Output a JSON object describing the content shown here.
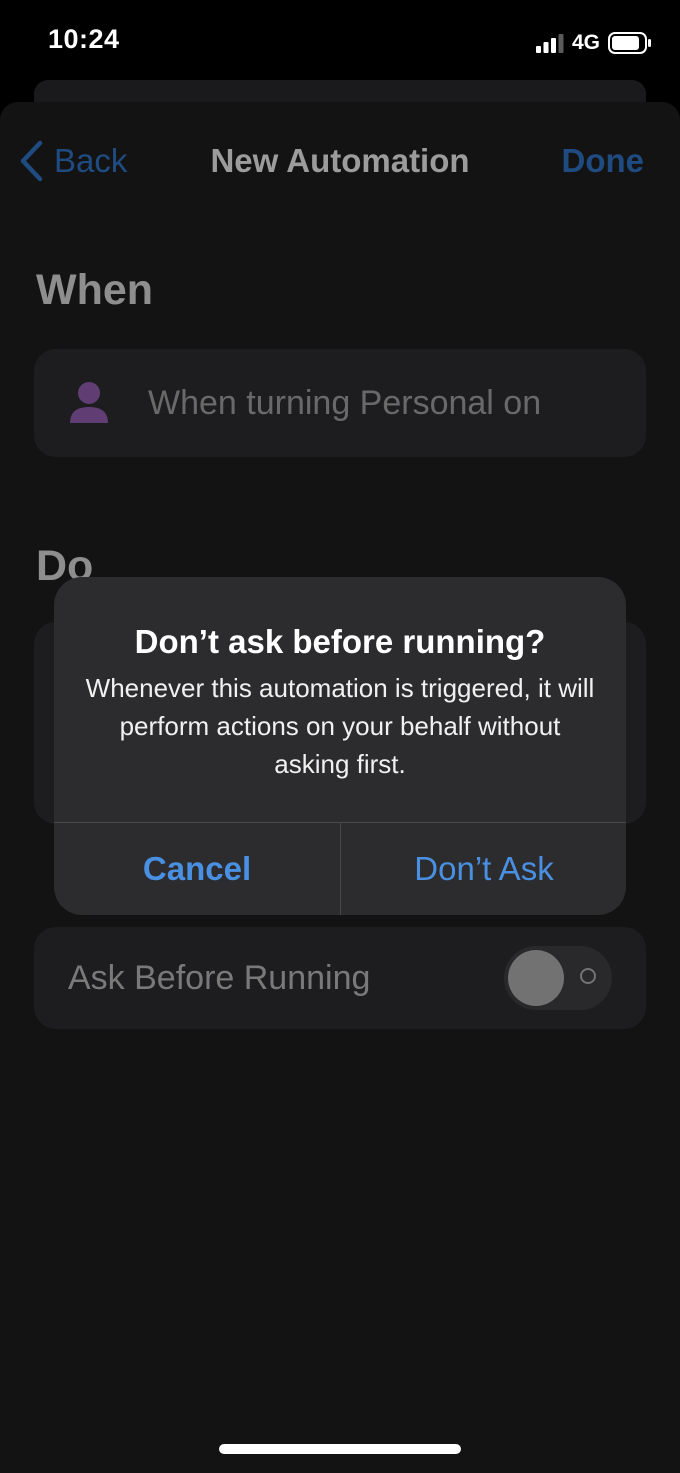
{
  "status_bar": {
    "time": "10:24",
    "network": "4G",
    "signal_icon": "cellular-signal-icon",
    "battery_icon": "battery-icon"
  },
  "nav": {
    "back_label": "Back",
    "title": "New Automation",
    "done_label": "Done"
  },
  "when_section": {
    "title": "When",
    "trigger_icon": "person-icon",
    "trigger_text": "When turning Personal on"
  },
  "do_section": {
    "title": "Do"
  },
  "ask_before_running": {
    "label": "Ask Before Running",
    "enabled": false
  },
  "alert": {
    "title": "Don’t ask before running?",
    "message": "Whenever this automation is triggered, it will perform actions on your behalf without asking first.",
    "cancel_label": "Cancel",
    "confirm_label": "Don’t Ask"
  },
  "colors": {
    "accent": "#4a90e2",
    "accent_dimmed": "#2f6fbf",
    "person_icon": "#8e5aa8",
    "sheet_background": "#1c1c1e",
    "card_background": "#2c2c2e"
  }
}
